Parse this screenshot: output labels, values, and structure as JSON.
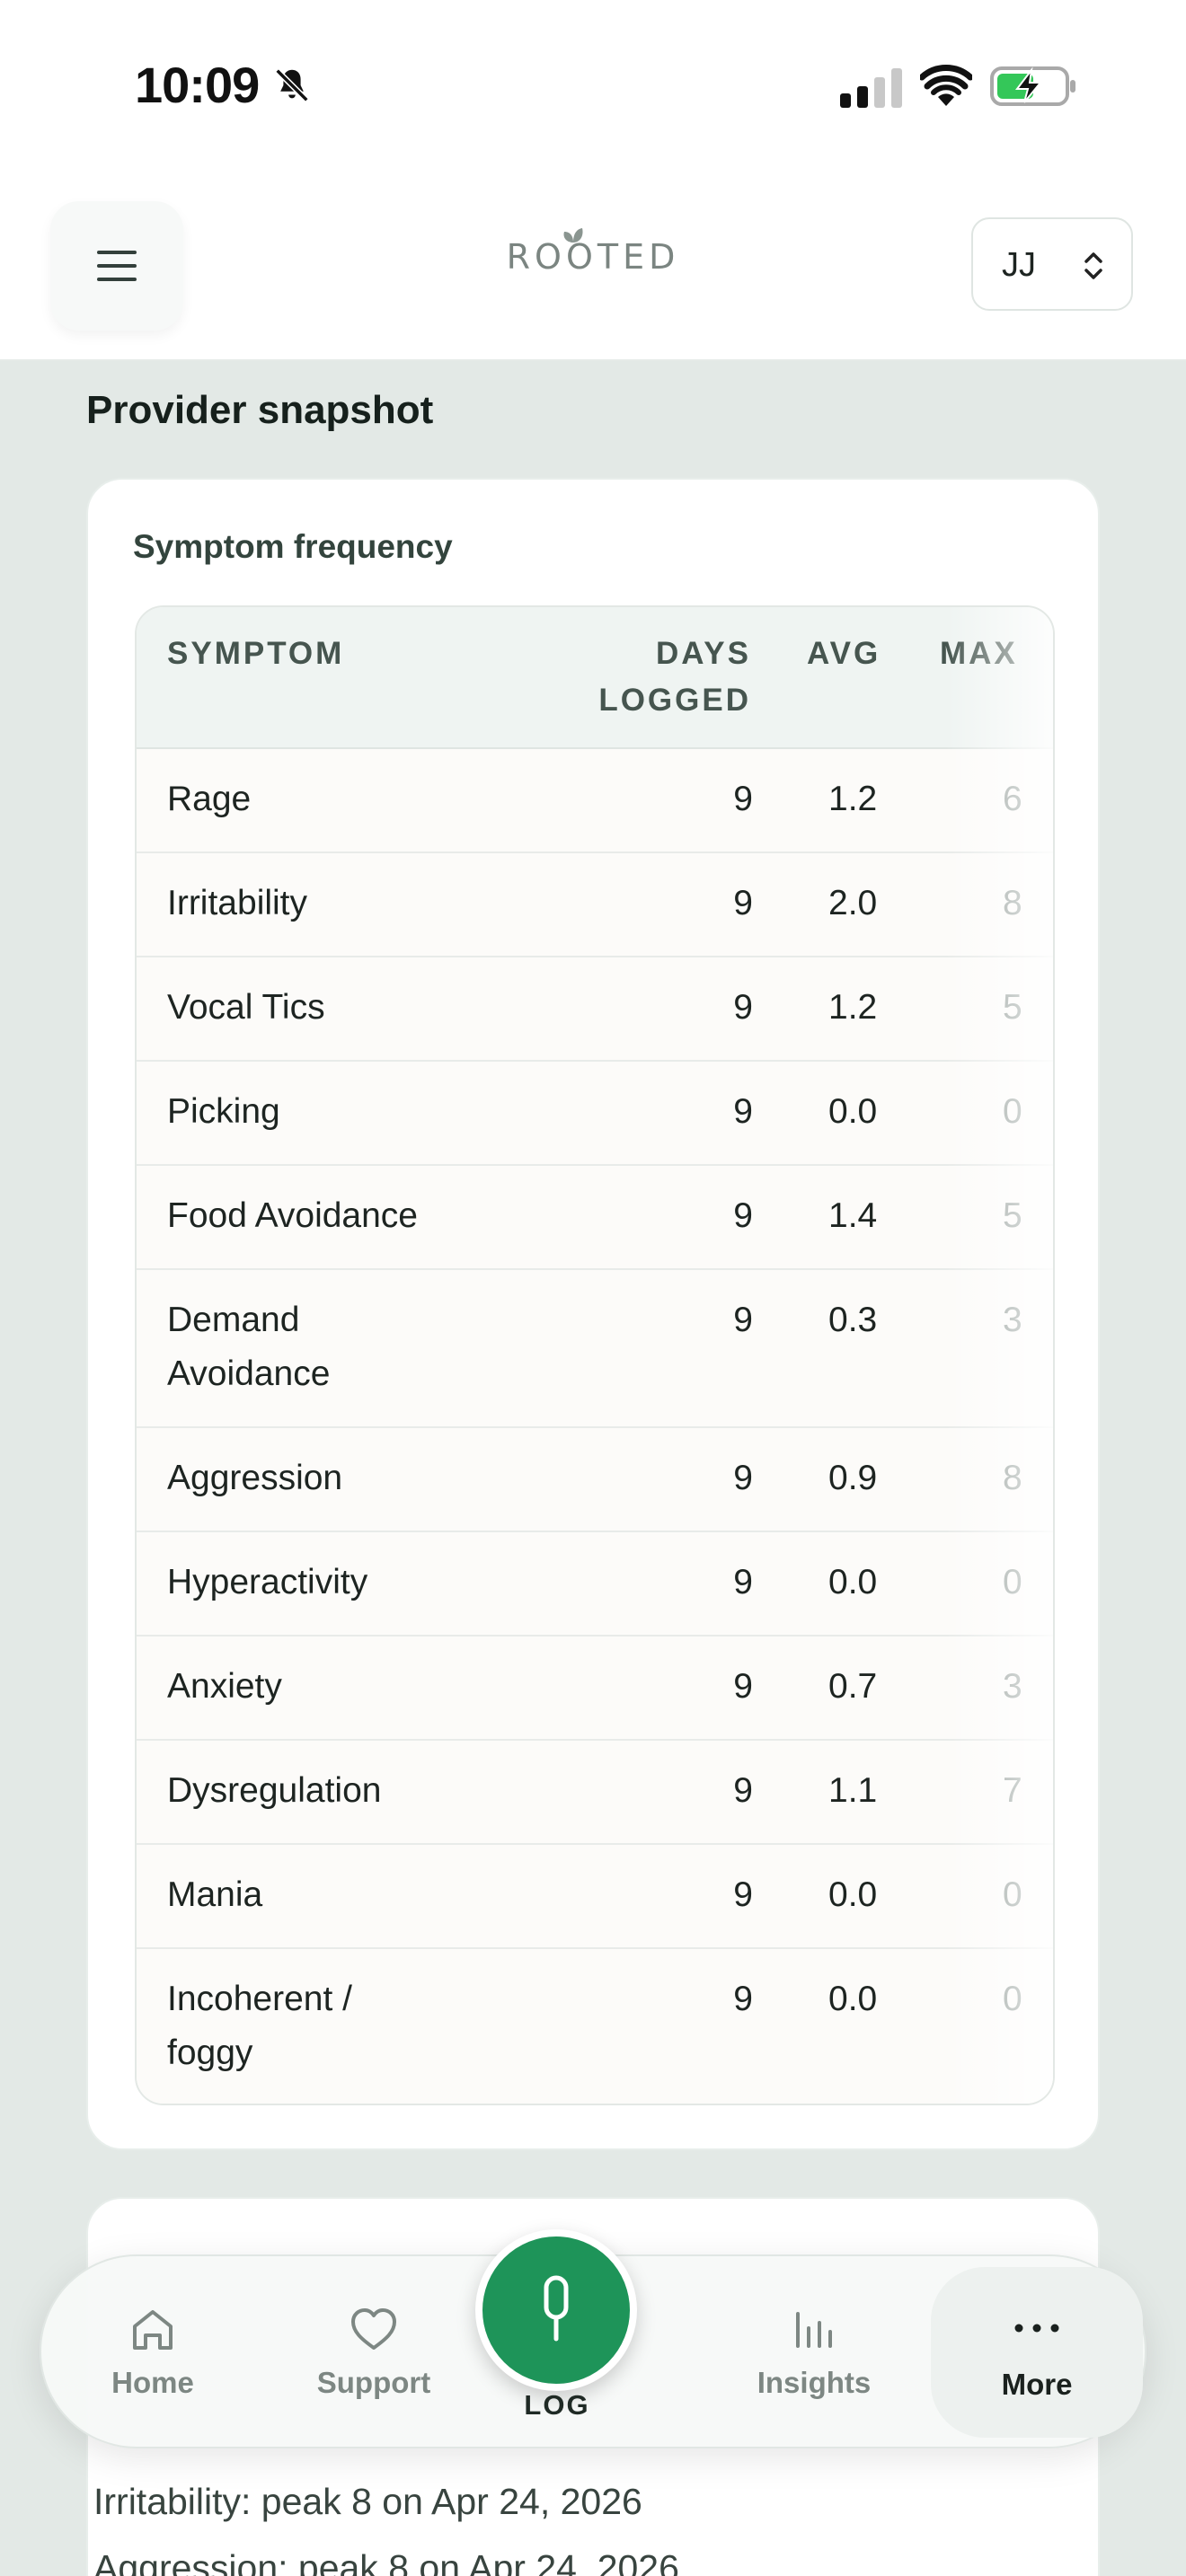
{
  "status_bar": {
    "time": "10:09"
  },
  "header": {
    "logo": "ROOTED",
    "profile": {
      "initials": "JJ"
    }
  },
  "section_title": "Provider snapshot",
  "symptom_card": {
    "title": "Symptom frequency",
    "columns": {
      "symptom": "SYMPTOM",
      "days_line1": "DAYS",
      "days_line2": "LOGGED",
      "avg": "AVG",
      "max": "MAX"
    },
    "rows": [
      {
        "name": "Rage",
        "days": "9",
        "avg": "1.2",
        "max": "6"
      },
      {
        "name": "Irritability",
        "days": "9",
        "avg": "2.0",
        "max": "8"
      },
      {
        "name": "Vocal Tics",
        "days": "9",
        "avg": "1.2",
        "max": "5"
      },
      {
        "name": "Picking",
        "days": "9",
        "avg": "0.0",
        "max": "0"
      },
      {
        "name": "Food Avoidance",
        "days": "9",
        "avg": "1.4",
        "max": "5"
      },
      {
        "name": "Demand Avoidance",
        "days": "9",
        "avg": "0.3",
        "max": "3"
      },
      {
        "name": "Aggression",
        "days": "9",
        "avg": "0.9",
        "max": "8"
      },
      {
        "name": "Hyperactivity",
        "days": "9",
        "avg": "0.0",
        "max": "0"
      },
      {
        "name": "Anxiety",
        "days": "9",
        "avg": "0.7",
        "max": "3"
      },
      {
        "name": "Dysregulation",
        "days": "9",
        "avg": "1.1",
        "max": "7"
      },
      {
        "name": "Mania",
        "days": "9",
        "avg": "0.0",
        "max": "0"
      },
      {
        "name": "Incoherent / foggy",
        "days": "9",
        "avg": "0.0",
        "max": "0"
      }
    ]
  },
  "peaks_card": {
    "lines": [
      "Irritability: peak 8 on Apr 24, 2026",
      "Aggression: peak 8 on Apr 24, 2026"
    ]
  },
  "bottom_nav": {
    "home": "Home",
    "support": "Support",
    "log": "LOG",
    "insights": "Insights",
    "more": "More"
  },
  "colors": {
    "accent": "#1e9459",
    "background": "#e3e9e6",
    "card": "#ffffff",
    "header_row": "#eff4f2"
  }
}
